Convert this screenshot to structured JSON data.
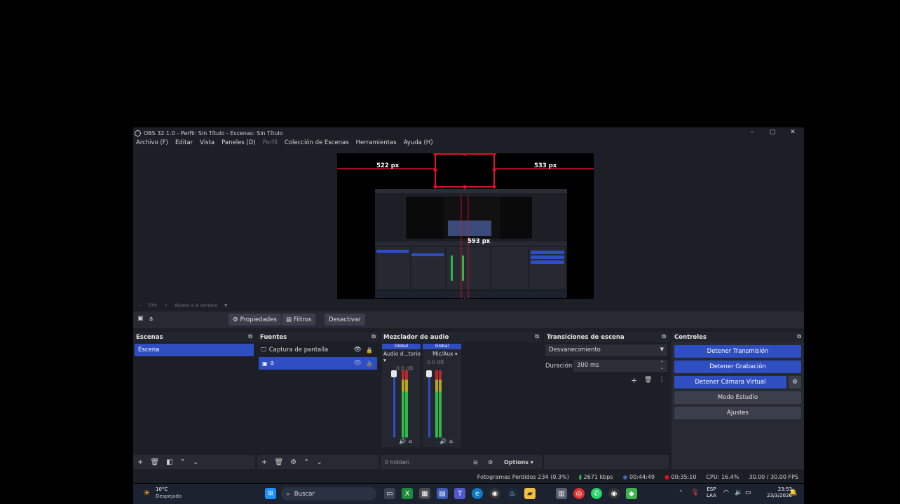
{
  "window": {
    "title": "OBS 32.1.0 - Perfil: Sin Título - Escenas: Sin Título",
    "minimize": "–",
    "maximize": "▢",
    "close": "✕"
  },
  "menu": [
    "Archivo (F)",
    "Editar",
    "Vista",
    "Paneles (D)",
    "Perfil",
    "Colección de Escenas",
    "Herramientas",
    "Ayuda (H)"
  ],
  "preview": {
    "measure_left": "522 px",
    "measure_right": "533 px",
    "measure_bottom": "593 px",
    "zoom_minus": "–",
    "zoom_value": "33%",
    "zoom_plus": "+",
    "zoom_fit": "Ajustar a la ventana"
  },
  "source_toolbar": {
    "selected_name": "a",
    "properties": "Propiedades",
    "filters": "Filtros",
    "deactivate": "Desactivar"
  },
  "scenes": {
    "title": "Escenas",
    "items": [
      "Escena"
    ]
  },
  "sources": {
    "title": "Fuentes",
    "items": [
      "Captura de pantalla",
      "a"
    ]
  },
  "mixer": {
    "title": "Mezclador de audio",
    "channels": [
      {
        "badge": "Global",
        "name": "Audio d...torio",
        "level": "0.0 dB"
      },
      {
        "badge": "Global",
        "name": "Mic/Aux",
        "level": "0.0 dB"
      }
    ],
    "scale": [
      "0",
      "-6",
      "-12",
      "-18",
      "-24",
      "-30",
      "-36",
      "-42",
      "-48",
      "-54",
      "-60"
    ],
    "hidden": "0 hidden",
    "options": "Options"
  },
  "transitions": {
    "title": "Transiciones de escena",
    "selected": "Desvanecimiento",
    "duration_label": "Duración",
    "duration_value": "300 ms"
  },
  "controls": {
    "title": "Controles",
    "stop_stream": "Detener Transmisión",
    "stop_record": "Detener Grabación",
    "stop_virtualcam": "Detener Cámara Virtual",
    "studio_mode": "Modo Estudio",
    "settings": "Ajustes"
  },
  "status": {
    "dropped": "Fotogramas Perdidos 234 (0.3%)",
    "bitrate": "2671 kbps",
    "stream_time": "00:44:49",
    "rec_time": "00:35:10",
    "cpu": "CPU: 16.4%",
    "fps": "30.00 / 30.00 FPS"
  },
  "taskbar": {
    "weather_temp": "10°C",
    "weather_desc": "Despejado",
    "search": "Buscar",
    "lang_top": "ESP",
    "lang_bottom": "LAA",
    "time": "23:53",
    "date": "23/3/2026"
  },
  "colors": {
    "accent": "#2f4ec1",
    "panel": "#272a33",
    "background": "#1d1f26",
    "guide_red": "#e0102a",
    "meter_green": "#2fb848",
    "meter_yellow": "#b6a522",
    "meter_red": "#b52a2a"
  }
}
